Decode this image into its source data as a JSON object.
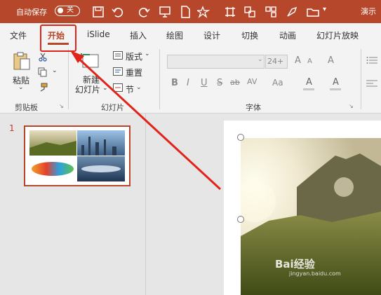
{
  "titlebar": {
    "autosave_label": "自动保存",
    "autosave_state": "关",
    "doc_title": "演示",
    "qat_icons": [
      "save-icon",
      "undo-icon",
      "redo-icon",
      "present-icon",
      "new-file-icon",
      "shapes-icon",
      "table-icon",
      "group-icon",
      "paint-icon",
      "open-folder-icon"
    ]
  },
  "tabs": [
    "文件",
    "开始",
    "iSlide",
    "插入",
    "绘图",
    "设计",
    "切换",
    "动画",
    "幻灯片放映"
  ],
  "active_tab": "开始",
  "ribbon": {
    "clipboard": {
      "paste": "粘贴",
      "group": "剪贴板"
    },
    "slides": {
      "new_slide_1": "新建",
      "new_slide_2": "幻灯片",
      "layout": "版式",
      "reset": "重置",
      "section": "节",
      "group": "幻灯片"
    },
    "font": {
      "size": "24+",
      "group": "字体",
      "buttons": [
        "B",
        "I",
        "U",
        "S",
        "ab",
        "AV",
        "Aa",
        "A",
        "A"
      ]
    }
  },
  "slides_pane": {
    "numbers": [
      "1"
    ]
  },
  "watermark": {
    "text": "Bai经验",
    "sub": "jingyan.baidu.com"
  },
  "colors": {
    "accent": "#b7472a",
    "highlight": "#e2231a"
  }
}
